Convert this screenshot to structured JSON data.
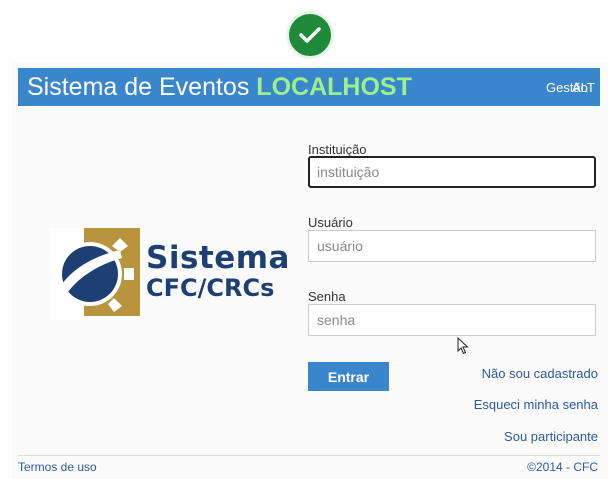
{
  "header": {
    "title_prefix": "Sistema de Eventos ",
    "title_env": "LOCALHOST",
    "gestao_label": "Gestão",
    "alt_label": "ALT"
  },
  "logo": {
    "line1": "Sistema",
    "line2": "CFC/CRCs"
  },
  "form": {
    "instituicao_label": "Instituição",
    "instituicao_placeholder": "instituição",
    "usuario_label": "Usuário",
    "usuario_placeholder": "usuário",
    "senha_label": "Senha",
    "senha_placeholder": "senha",
    "submit_label": "Entrar"
  },
  "links": {
    "nao_cadastrado": "Não sou cadastrado",
    "esqueci_senha": "Esqueci minha senha",
    "sou_participante": "Sou participante"
  },
  "footer": {
    "terms": "Termos de uso",
    "copyright": "©2014 - CFC"
  },
  "colors": {
    "header": "#3a86cd",
    "env_highlight": "#9df08a",
    "logo_blue": "#1e3f72",
    "logo_gold": "#b8943f",
    "link": "#2c5aa0",
    "check_green": "#1f8a3a"
  },
  "icons": {
    "badge": "checkmark-icon",
    "cursor": "mouse-pointer-icon"
  }
}
